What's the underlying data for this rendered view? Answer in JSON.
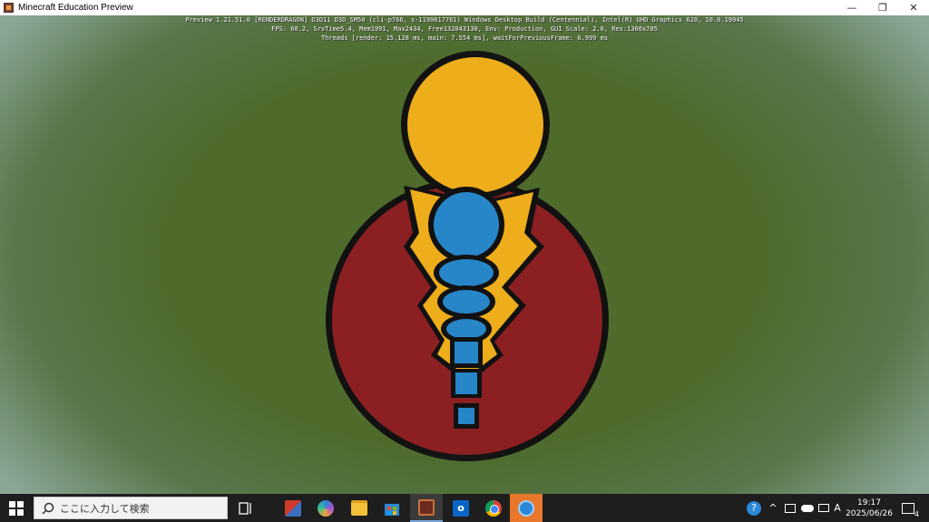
{
  "window": {
    "title": "Minecraft Education Preview",
    "minimize_glyph": "—",
    "restore_glyph": "❐",
    "close_glyph": "✕"
  },
  "debug_overlay": {
    "line1": "Preview 1.21.51.0 [RENDERDRAGON] D3D11 D3D_SM50 (cli-p766, s-1190617761) Windows Desktop Build (Centennial), Intel(R) UHD Graphics 620, 10.0.19045",
    "line2": "FPS: 60.2, SrvTime5.4, Mem1991, Max2434, Free132043130, Env: Production, GUI Scale: 2.0, Res:1366x705",
    "line3": "Threads [render: 15.128 ms, main: 7.554 ms], waitForPreviousFrame: 6.999 ms"
  },
  "colors": {
    "grass": "#4e6b2c",
    "red": "#8b1f22",
    "yellow": "#eead1a",
    "blue": "#2686c8",
    "outline": "#111111",
    "taskbar": "#1e1e1e"
  },
  "taskbar": {
    "search_placeholder": "ここに入力して検索",
    "apps": [
      "task-view",
      "minecraft-launcher",
      "copilot",
      "file-explorer",
      "microsoft-store",
      "minecraft-education",
      "outlook",
      "chrome",
      "browser-active"
    ],
    "tray": {
      "help_glyph": "?",
      "chevron_glyph": "^",
      "ime_glyph": "A",
      "time": "19:17",
      "date": "2025/06/26",
      "notification_count": "4"
    }
  }
}
